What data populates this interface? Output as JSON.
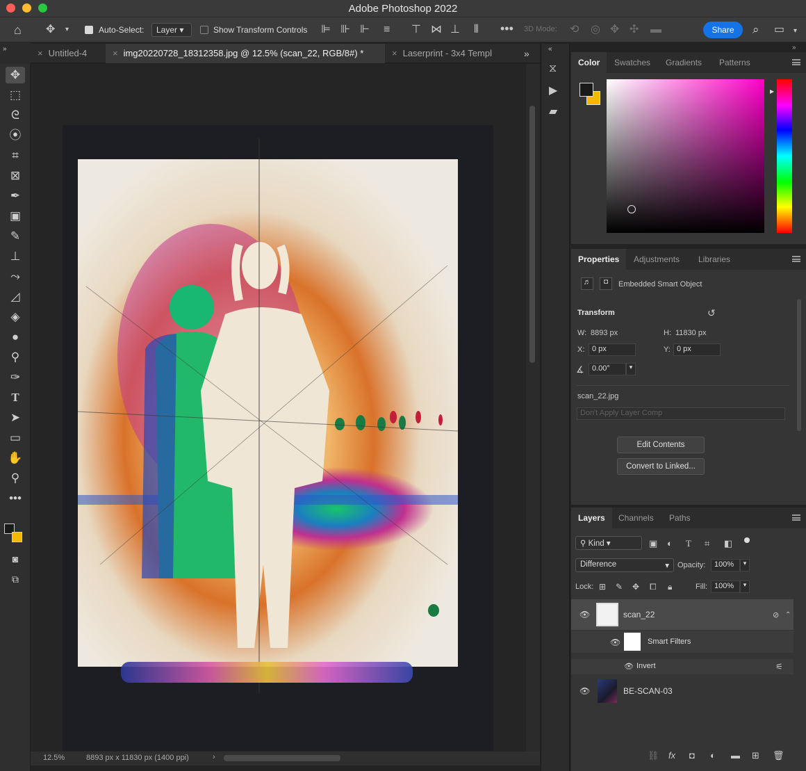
{
  "window": {
    "title": "Adobe Photoshop 2022"
  },
  "options_bar": {
    "auto_select_label": "Auto-Select:",
    "auto_select_value": "Layer",
    "show_transform_label": "Show Transform Controls",
    "mode_3d_label": "3D Mode:",
    "share_label": "Share"
  },
  "doc_tabs": [
    {
      "label": "Untitled-4"
    },
    {
      "label": "img20220728_18312358.jpg @ 12.5% (scan_22, RGB/8#) *"
    },
    {
      "label": "Laserprint - 3x4 Templ"
    }
  ],
  "status": {
    "zoom": "12.5%",
    "doc_info": "8893 px x 11830 px (1400 ppi)"
  },
  "color_panel": {
    "tabs": [
      "Color",
      "Swatches",
      "Gradients",
      "Patterns"
    ],
    "foreground": "#1a1a1a",
    "background": "#f5b800",
    "picker_hue": "#ff00c8"
  },
  "properties": {
    "tabs": [
      "Properties",
      "Adjustments",
      "Libraries"
    ],
    "object_type": "Embedded Smart Object",
    "transform_label": "Transform",
    "w_label": "W:",
    "w_value": "8893 px",
    "h_label": "H:",
    "h_value": "11830 px",
    "x_label": "X:",
    "x_value": "0 px",
    "y_label": "Y:",
    "y_value": "0 px",
    "angle_value": "0.00°",
    "source_file": "scan_22.jpg",
    "layer_comp_placeholder": "Don't Apply Layer Comp",
    "edit_contents": "Edit Contents",
    "convert_linked": "Convert to Linked..."
  },
  "layers_panel": {
    "tabs": [
      "Layers",
      "Channels",
      "Paths"
    ],
    "filter_kind": "Kind",
    "blend_mode": "Difference",
    "opacity_label": "Opacity:",
    "opacity_value": "100%",
    "lock_label": "Lock:",
    "fill_label": "Fill:",
    "fill_value": "100%",
    "layers": [
      {
        "name": "scan_22"
      },
      {
        "name": "Smart Filters"
      },
      {
        "name": "Invert"
      },
      {
        "name": "BE-SCAN-03"
      }
    ]
  }
}
